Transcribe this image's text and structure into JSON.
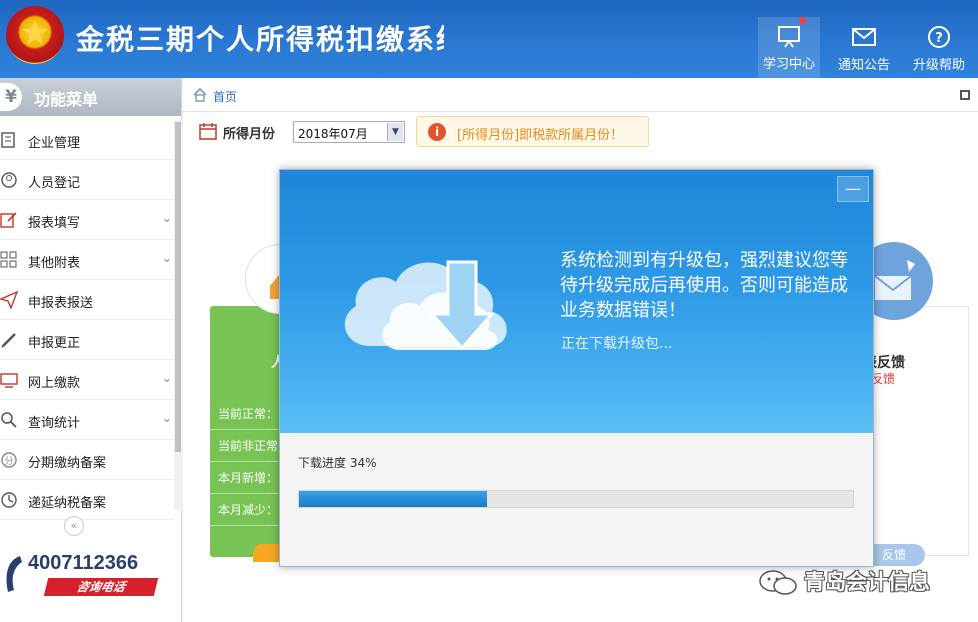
{
  "header": {
    "title": "金税三期个人所得税扣缴系统",
    "buttons": [
      {
        "label": "学习中心",
        "icon": "presentation-icon",
        "has_notification": true
      },
      {
        "label": "通知公告",
        "icon": "mail-icon"
      },
      {
        "label": "升级帮助",
        "icon": "help-icon"
      }
    ]
  },
  "sidebar": {
    "title": "功能菜单",
    "items": [
      {
        "label": "企业管理",
        "icon": "document-icon",
        "expandable": false
      },
      {
        "label": "人员登记",
        "icon": "person-icon",
        "expandable": false
      },
      {
        "label": "报表填写",
        "icon": "edit-icon",
        "expandable": true
      },
      {
        "label": "其他附表",
        "icon": "grid-icon",
        "expandable": true
      },
      {
        "label": "申报表报送",
        "icon": "send-icon",
        "expandable": false
      },
      {
        "label": "申报更正",
        "icon": "pencil-icon",
        "expandable": false
      },
      {
        "label": "网上缴款",
        "icon": "payment-icon",
        "expandable": true
      },
      {
        "label": "查询统计",
        "icon": "search-icon",
        "expandable": true
      },
      {
        "label": "分期缴纳备案",
        "icon": "installment-icon",
        "expandable": false
      },
      {
        "label": "递延纳税备案",
        "icon": "clock-icon",
        "expandable": false
      }
    ],
    "collapse_symbol": "«",
    "hotline": {
      "number": "4007112366",
      "label": "咨询电话"
    }
  },
  "breadcrumb": {
    "home": "首页"
  },
  "filter": {
    "label": "所得月份",
    "selected_month": "2018年07月",
    "hint": "[所得月份]即税款所属月份！"
  },
  "cards": {
    "left": {
      "title_fragment": "人",
      "rows": [
        "当前正常：",
        "当前非正常",
        "本月新增：",
        "本月减少："
      ]
    },
    "right": {
      "title": "表反馈",
      "subtitle": "反馈",
      "button": "反馈"
    }
  },
  "dialog": {
    "minimize_symbol": "—",
    "message": "系统检测到有升级包，强烈建议您等待升级完成后再使用。否则可能造成业务数据错误！",
    "status": "正在下载升级包...",
    "progress_label": "下载进度 34%",
    "progress_percent": 34
  },
  "watermark": {
    "text": "青岛会计信息"
  }
}
